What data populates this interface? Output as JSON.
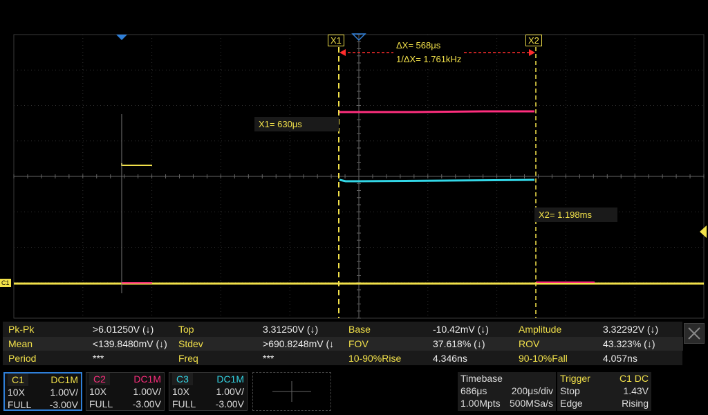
{
  "cursors": {
    "x1_label": "X1",
    "x2_label": "X2",
    "delta_x": "ΔX= 568μs",
    "inv_delta_x": "1/ΔX= 1.761kHz",
    "x1_readout": "X1= 630μs",
    "x2_readout": "X2= 1.198ms"
  },
  "channel_marker": "C1",
  "colors": {
    "c1": "#f2e14a",
    "c2": "#ff2e7e",
    "c3": "#33d6e6",
    "accent": "#2f7fd8"
  },
  "measurements": [
    [
      {
        "label": "Pk-Pk",
        "value": ">6.01250V (↓)"
      },
      {
        "label": "Top",
        "value": "3.31250V (↓)"
      },
      {
        "label": "Base",
        "value": "-10.42mV (↓)"
      },
      {
        "label": "Amplitude",
        "value": "3.32292V (↓)"
      }
    ],
    [
      {
        "label": "Mean",
        "value": "<139.8480mV (↓)"
      },
      {
        "label": "Stdev",
        "value": ">690.8248mV (↓"
      },
      {
        "label": "FOV",
        "value": "37.618% (↓)"
      },
      {
        "label": "ROV",
        "value": "43.323% (↓)"
      }
    ],
    [
      {
        "label": "Period",
        "value": "***"
      },
      {
        "label": "Freq",
        "value": "***"
      },
      {
        "label": "10-90%Rise",
        "value": "4.346ns"
      },
      {
        "label": "90-10%Fall",
        "value": "4.057ns"
      }
    ]
  ],
  "channels": [
    {
      "name": "C1",
      "coupling": "DC1M",
      "probe": "10X",
      "scale": "1.00V/",
      "bw": "FULL",
      "offset": "-3.00V"
    },
    {
      "name": "C2",
      "coupling": "DC1M",
      "probe": "10X",
      "scale": "1.00V/",
      "bw": "FULL",
      "offset": "-3.00V"
    },
    {
      "name": "C3",
      "coupling": "DC1M",
      "probe": "10X",
      "scale": "1.00V/",
      "bw": "FULL",
      "offset": "-3.00V"
    }
  ],
  "timebase": {
    "title": "Timebase",
    "delay": "686μs",
    "scale": "200μs/div",
    "points": "1.00Mpts",
    "rate": "500MSa/s"
  },
  "trigger": {
    "title": "Trigger",
    "source": "C1 DC",
    "mode": "Stop",
    "level": "1.43V",
    "type": "Edge",
    "slope": "Rising"
  }
}
